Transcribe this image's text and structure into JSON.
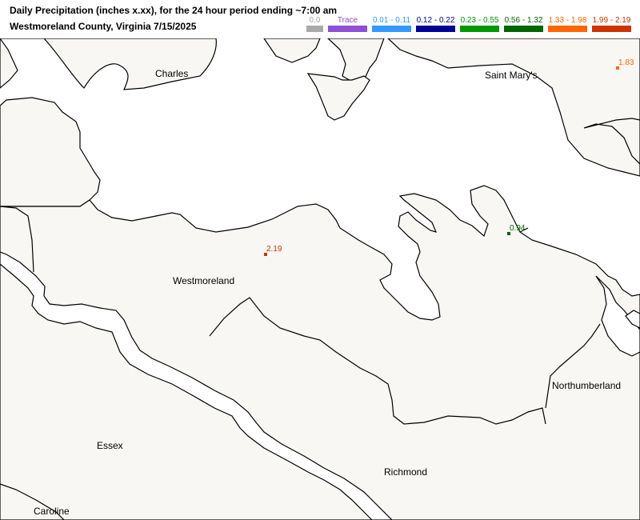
{
  "title": {
    "line1": "Daily Precipitation (inches  x.xx),  for the 24 hour period ending ~7:00 am",
    "line2": "Westmoreland County, Virginia  7/15/2025"
  },
  "legend": [
    {
      "label": "0.0",
      "color": "#a9a9a9"
    },
    {
      "label": "Trace",
      "color": "#8e4fd6"
    },
    {
      "label": "0.01 - 0.11",
      "color": "#3399ff"
    },
    {
      "label": "0.12 - 0.22",
      "color": "#000099"
    },
    {
      "label": "0.23 - 0.55",
      "color": "#009900"
    },
    {
      "label": "0.56 - 1.32",
      "color": "#006600"
    },
    {
      "label": "1.33 - 1.98",
      "color": "#ff6600"
    },
    {
      "label": "1.99 - 2.19",
      "color": "#cc3300"
    }
  ],
  "counties": [
    "Charles",
    "Saint Mary's",
    "Westmoreland",
    "Northumberland",
    "Essex",
    "Richmond",
    "Caroline"
  ],
  "stations": [
    {
      "value": "2.19",
      "color": "#cc3300"
    },
    {
      "value": "0.94",
      "color": "#006600"
    },
    {
      "value": "1.83",
      "color": "#ff6600"
    }
  ],
  "colors": {
    "land": "#f8f7f3",
    "water": "#ffffff",
    "boundary": "#000000"
  }
}
